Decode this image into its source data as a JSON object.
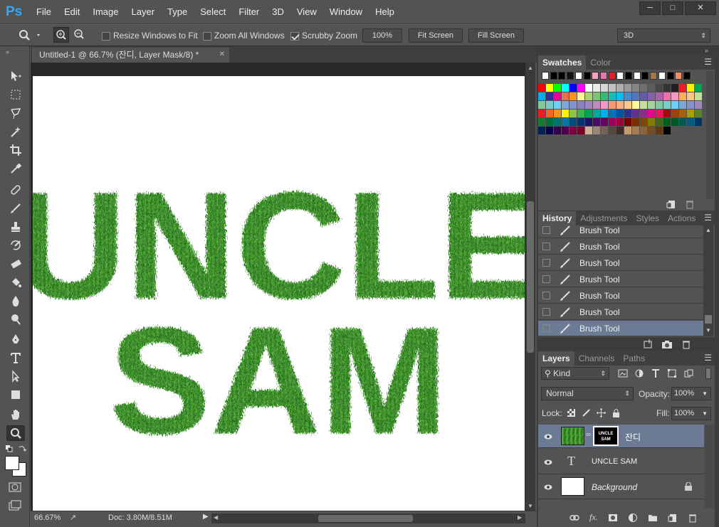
{
  "app": {
    "logo": "Ps",
    "menus": [
      "File",
      "Edit",
      "Image",
      "Layer",
      "Type",
      "Select",
      "Filter",
      "3D",
      "View",
      "Window",
      "Help"
    ]
  },
  "options": {
    "resize_windows": "Resize Windows to Fit",
    "zoom_all": "Zoom All Windows",
    "scrubby": "Scrubby Zoom",
    "zoom_btn": "100%",
    "fit_screen": "Fit Screen",
    "fill_screen": "Fill Screen",
    "workspace": "3D"
  },
  "document": {
    "tab_title": "Untitled-1 @ 66.7% (잔디, Layer Mask/8) *",
    "line1": "UNCLE",
    "line2": "SAM",
    "zoom": "66.67%",
    "doc_info": "Doc: 3.80M/8.51M"
  },
  "swatches": {
    "tab_active": "Swatches",
    "tab_other": "Color",
    "row0": [
      "#ffffff",
      "#000000",
      "#000000",
      "#111111",
      "#ffffff",
      "#000000",
      "#f2a1c0",
      "#e878b0",
      "#ed1c24",
      "#ffffff",
      "#000000",
      "#ffffff",
      "#000000",
      "#a07850",
      "#ffffff",
      "#000000",
      "#f28c63",
      "#000000"
    ],
    "grid": [
      [
        "#ff0000",
        "#ffff00",
        "#00ff00",
        "#00ffff",
        "#0000ff",
        "#ff00ff",
        "#ffffff",
        "#ebebeb",
        "#d6d6d6",
        "#c2c2c2",
        "#adadad",
        "#999999",
        "#858585",
        "#707070",
        "#5c5c5c",
        "#474747",
        "#333333",
        "#1f1f1f",
        "#ed1c24",
        "#fff200",
        "#00a651"
      ],
      [
        "#00aeef",
        "#2e3192",
        "#ec008c",
        "#f26c4f",
        "#f7941d",
        "#fff799",
        "#acd373",
        "#7cc576",
        "#3bb878",
        "#1abbb4",
        "#00bff3",
        "#438ccb",
        "#5574b9",
        "#605ca8",
        "#8560a8",
        "#a763a8",
        "#f06ea9",
        "#f49ac2",
        "#fbaf5d",
        "#fdc689",
        "#c4df9b"
      ],
      [
        "#82ca9c",
        "#7accc8",
        "#6dcff6",
        "#7ea7d8",
        "#8493ca",
        "#8882be",
        "#a187be",
        "#bc8cbf",
        "#f29ac2",
        "#f7977a",
        "#f9ad81",
        "#fdc68a",
        "#fff79a",
        "#c4df9b",
        "#a3d39c",
        "#82ca9d",
        "#7bcdc8",
        "#6ecff6",
        "#7ea7d8",
        "#8393ca",
        "#a286be"
      ],
      [
        "#ee1c24",
        "#f26522",
        "#f7941d",
        "#fff200",
        "#8dc73f",
        "#39b54a",
        "#00a651",
        "#00a99d",
        "#00aeef",
        "#0072bc",
        "#0054a6",
        "#2e3192",
        "#662d91",
        "#92278f",
        "#ec008c",
        "#ed145b",
        "#9e0b0f",
        "#a0410d",
        "#a3620a",
        "#aba000",
        "#598527"
      ],
      [
        "#197b30",
        "#007236",
        "#00746b",
        "#0076a3",
        "#004b80",
        "#003471",
        "#1b1464",
        "#440e62",
        "#630460",
        "#9e005d",
        "#9e0039",
        "#790000",
        "#7b2e00",
        "#7d4900",
        "#827b00",
        "#406618",
        "#005e20",
        "#005826",
        "#005952",
        "#005b7f",
        "#003663"
      ],
      [
        "#002157",
        "#0d004c",
        "#32004b",
        "#4b0049",
        "#7b0046",
        "#7a0026",
        "#c7b299",
        "#998675",
        "#736357",
        "#534741",
        "#37302a",
        "#c69c6d",
        "#a67c52",
        "#8c6239",
        "#754c24",
        "#603913",
        "#000000"
      ]
    ]
  },
  "history": {
    "tabs": [
      "History",
      "Adjustments",
      "Styles",
      "Actions"
    ],
    "rows": [
      "Brush Tool",
      "Brush Tool",
      "Brush Tool",
      "Brush Tool",
      "Brush Tool",
      "Brush Tool",
      "Brush Tool"
    ]
  },
  "layers": {
    "tabs": [
      "Layers",
      "Channels",
      "Paths"
    ],
    "kind": "Kind",
    "blend": "Normal",
    "opacity_label": "Opacity:",
    "opacity": "100%",
    "lock_label": "Lock:",
    "fill_label": "Fill:",
    "fill": "100%",
    "items": [
      {
        "name": "잔디",
        "mask_text": "UNCLE SAM"
      },
      {
        "name": "UNCLE SAM",
        "icon": "T"
      },
      {
        "name": "Background"
      }
    ]
  }
}
